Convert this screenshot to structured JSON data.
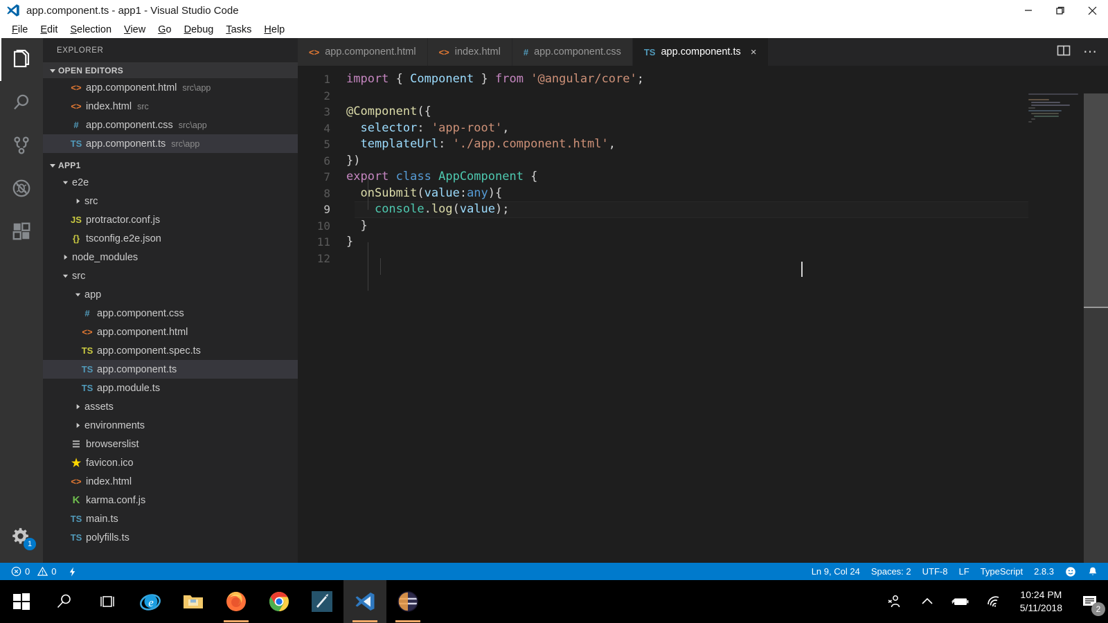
{
  "window": {
    "title": "app.component.ts - app1 - Visual Studio Code",
    "controls": {
      "minimize": "minimize-icon",
      "restore": "restore-icon",
      "close": "close-icon"
    }
  },
  "menubar": {
    "items": [
      {
        "label": "File",
        "accel": "F"
      },
      {
        "label": "Edit",
        "accel": "E"
      },
      {
        "label": "Selection",
        "accel": "S"
      },
      {
        "label": "View",
        "accel": "V"
      },
      {
        "label": "Go",
        "accel": "G"
      },
      {
        "label": "Debug",
        "accel": "D"
      },
      {
        "label": "Tasks",
        "accel": "T"
      },
      {
        "label": "Help",
        "accel": "H"
      }
    ]
  },
  "activitybar": {
    "items": [
      {
        "name": "explorer",
        "icon": "files-icon",
        "active": true
      },
      {
        "name": "search",
        "icon": "search-icon",
        "active": false
      },
      {
        "name": "source-control",
        "icon": "source-control-icon",
        "active": false
      },
      {
        "name": "debug",
        "icon": "debug-icon",
        "active": false
      },
      {
        "name": "extensions",
        "icon": "extensions-icon",
        "active": false
      }
    ],
    "settings": {
      "icon": "gear-icon",
      "badge": "1"
    }
  },
  "sidebar": {
    "title": "EXPLORER",
    "open_editors": {
      "header": "OPEN EDITORS",
      "items": [
        {
          "icon": "html",
          "icon_label": "<>",
          "name": "app.component.html",
          "path": "src\\app",
          "selected": false
        },
        {
          "icon": "html",
          "icon_label": "<>",
          "name": "index.html",
          "path": "src",
          "selected": false
        },
        {
          "icon": "css",
          "icon_label": "#",
          "name": "app.component.css",
          "path": "src\\app",
          "selected": false
        },
        {
          "icon": "ts",
          "icon_label": "TS",
          "name": "app.component.ts",
          "path": "src\\app",
          "selected": true
        }
      ]
    },
    "project": {
      "header": "APP1",
      "tree": [
        {
          "kind": "folder",
          "name": "e2e",
          "indent": 1,
          "expanded": true
        },
        {
          "kind": "folder",
          "name": "src",
          "indent": 2,
          "expanded": false
        },
        {
          "kind": "file",
          "icon": "js",
          "icon_label": "JS",
          "name": "protractor.conf.js",
          "indent": 2
        },
        {
          "kind": "file",
          "icon": "json",
          "icon_label": "{}",
          "name": "tsconfig.e2e.json",
          "indent": 2
        },
        {
          "kind": "folder",
          "name": "node_modules",
          "indent": 1,
          "expanded": false
        },
        {
          "kind": "folder",
          "name": "src",
          "indent": 1,
          "expanded": true
        },
        {
          "kind": "folder",
          "name": "app",
          "indent": 2,
          "expanded": true
        },
        {
          "kind": "file",
          "icon": "css",
          "icon_label": "#",
          "name": "app.component.css",
          "indent": 3
        },
        {
          "kind": "file",
          "icon": "html",
          "icon_label": "<>",
          "name": "app.component.html",
          "indent": 3
        },
        {
          "kind": "file",
          "icon": "ts-test",
          "icon_label": "TS",
          "name": "app.component.spec.ts",
          "indent": 3
        },
        {
          "kind": "file",
          "icon": "ts",
          "icon_label": "TS",
          "name": "app.component.ts",
          "indent": 3,
          "selected": true
        },
        {
          "kind": "file",
          "icon": "ts",
          "icon_label": "TS",
          "name": "app.module.ts",
          "indent": 3
        },
        {
          "kind": "folder",
          "name": "assets",
          "indent": 2,
          "expanded": false
        },
        {
          "kind": "folder",
          "name": "environments",
          "indent": 2,
          "expanded": false
        },
        {
          "kind": "file",
          "icon": "list",
          "icon_label": "☰",
          "name": "browserslist",
          "indent": 2
        },
        {
          "kind": "file",
          "icon": "star",
          "icon_label": "★",
          "name": "favicon.ico",
          "indent": 2
        },
        {
          "kind": "file",
          "icon": "html",
          "icon_label": "<>",
          "name": "index.html",
          "indent": 2
        },
        {
          "kind": "file",
          "icon": "karma",
          "icon_label": "K",
          "name": "karma.conf.js",
          "indent": 2
        },
        {
          "kind": "file",
          "icon": "ts",
          "icon_label": "TS",
          "name": "main.ts",
          "indent": 2
        },
        {
          "kind": "file",
          "icon": "ts",
          "icon_label": "TS",
          "name": "polyfills.ts",
          "indent": 2
        }
      ]
    }
  },
  "editor": {
    "tabs": [
      {
        "icon_label": "<>",
        "icon": "html",
        "label": "app.component.html",
        "active": false
      },
      {
        "icon_label": "<>",
        "icon": "html",
        "label": "index.html",
        "active": false
      },
      {
        "icon_label": "#",
        "icon": "css",
        "label": "app.component.css",
        "active": false
      },
      {
        "icon_label": "TS",
        "icon": "ts",
        "label": "app.component.ts",
        "active": true,
        "close": "×"
      }
    ],
    "actions": [
      {
        "name": "split-editor-icon"
      },
      {
        "name": "more-actions-icon",
        "label": "⋯"
      }
    ],
    "lines": [
      {
        "n": "1",
        "tokens": [
          {
            "t": "import",
            "c": "k-purple"
          },
          {
            "t": " ",
            "c": "k-white"
          },
          {
            "t": "{",
            "c": "k-white"
          },
          {
            "t": " Component ",
            "c": "k-ltblue"
          },
          {
            "t": "}",
            "c": "k-white"
          },
          {
            "t": " ",
            "c": "k-white"
          },
          {
            "t": "from",
            "c": "k-purple"
          },
          {
            "t": " ",
            "c": "k-white"
          },
          {
            "t": "'@angular/core'",
            "c": "k-orange"
          },
          {
            "t": ";",
            "c": "k-white"
          }
        ]
      },
      {
        "n": "2",
        "tokens": []
      },
      {
        "n": "3",
        "tokens": [
          {
            "t": "@Component",
            "c": "k-yellow"
          },
          {
            "t": "({",
            "c": "k-white"
          }
        ]
      },
      {
        "n": "4",
        "tokens": [
          {
            "t": "  ",
            "c": "k-white"
          },
          {
            "t": "selector",
            "c": "k-ltblue"
          },
          {
            "t": ": ",
            "c": "k-white"
          },
          {
            "t": "'app-root'",
            "c": "k-orange"
          },
          {
            "t": ",",
            "c": "k-white"
          }
        ]
      },
      {
        "n": "5",
        "tokens": [
          {
            "t": "  ",
            "c": "k-white"
          },
          {
            "t": "templateUrl",
            "c": "k-ltblue"
          },
          {
            "t": ": ",
            "c": "k-white"
          },
          {
            "t": "'./app.component.html'",
            "c": "k-orange"
          },
          {
            "t": ",",
            "c": "k-white"
          }
        ]
      },
      {
        "n": "6",
        "tokens": [
          {
            "t": "})",
            "c": "k-white"
          }
        ]
      },
      {
        "n": "7",
        "tokens": [
          {
            "t": "export",
            "c": "k-purple"
          },
          {
            "t": " ",
            "c": "k-white"
          },
          {
            "t": "class",
            "c": "k-blue"
          },
          {
            "t": " ",
            "c": "k-white"
          },
          {
            "t": "AppComponent",
            "c": "k-teal"
          },
          {
            "t": " {",
            "c": "k-white"
          }
        ]
      },
      {
        "n": "8",
        "tokens": [
          {
            "t": "  ",
            "c": "k-white"
          },
          {
            "t": "onSubmit",
            "c": "k-yellow"
          },
          {
            "t": "(",
            "c": "k-white"
          },
          {
            "t": "value",
            "c": "k-ltblue"
          },
          {
            "t": ":",
            "c": "k-white"
          },
          {
            "t": "any",
            "c": "k-blue"
          },
          {
            "t": "){",
            "c": "k-white"
          }
        ]
      },
      {
        "n": "9",
        "current": true,
        "tokens": [
          {
            "t": "    ",
            "c": "k-white"
          },
          {
            "t": "console",
            "c": "k-teal"
          },
          {
            "t": ".",
            "c": "k-white"
          },
          {
            "t": "log",
            "c": "k-yellow"
          },
          {
            "t": "(",
            "c": "k-white"
          },
          {
            "t": "value",
            "c": "k-ltblue"
          },
          {
            "t": ");",
            "c": "k-white"
          }
        ]
      },
      {
        "n": "10",
        "tokens": [
          {
            "t": "  }",
            "c": "k-white"
          }
        ]
      },
      {
        "n": "11",
        "tokens": [
          {
            "t": "}",
            "c": "k-white"
          }
        ]
      },
      {
        "n": "12",
        "tokens": []
      }
    ]
  },
  "statusbar": {
    "left": [
      {
        "name": "problems",
        "icon": "error-icon",
        "label": "0",
        "icon2": "warning-icon",
        "label2": "0"
      },
      {
        "name": "live-share",
        "icon": "bolt-icon",
        "label": ""
      }
    ],
    "errors": "0",
    "warnings": "0",
    "right": [
      {
        "name": "cursor-position",
        "label": "Ln 9, Col 24"
      },
      {
        "name": "indentation",
        "label": "Spaces: 2"
      },
      {
        "name": "encoding",
        "label": "UTF-8"
      },
      {
        "name": "eol",
        "label": "LF"
      },
      {
        "name": "language-mode",
        "label": "TypeScript"
      },
      {
        "name": "typescript-version",
        "label": "2.8.3"
      },
      {
        "name": "feedback-smiley",
        "label": "☺"
      },
      {
        "name": "notifications-bell",
        "label": "🔔"
      }
    ]
  },
  "taskbar": {
    "items": [
      {
        "name": "start-button",
        "icon": "windows-logo-icon"
      },
      {
        "name": "search-button",
        "icon": "search-icon"
      },
      {
        "name": "task-view-button",
        "icon": "task-view-icon"
      },
      {
        "name": "internet-explorer",
        "icon": "ie-icon"
      },
      {
        "name": "file-explorer",
        "icon": "folder-icon"
      },
      {
        "name": "firefox",
        "icon": "firefox-icon",
        "running": true
      },
      {
        "name": "google-chrome",
        "icon": "chrome-icon"
      },
      {
        "name": "editor-app",
        "icon": "cursor-app-icon"
      },
      {
        "name": "visual-studio-code",
        "icon": "vscode-icon",
        "active": true
      },
      {
        "name": "terminal-app",
        "icon": "terminal-app-icon",
        "running": true
      }
    ],
    "tray": [
      {
        "name": "people-icon"
      },
      {
        "name": "show-hidden-icons-chevron"
      },
      {
        "name": "battery-charging-icon"
      },
      {
        "name": "wifi-icon"
      }
    ],
    "clock": {
      "time": "10:24 PM",
      "date": "5/11/2018"
    },
    "notifications": {
      "icon": "action-center-icon",
      "badge": "2"
    }
  },
  "colors": {
    "accent": "#007acc",
    "titlebar_bg": "#ffffff",
    "sidebar_bg": "#252526",
    "editor_bg": "#1e1e1e",
    "activitybar_bg": "#333333",
    "taskbar_bg": "#000000"
  }
}
